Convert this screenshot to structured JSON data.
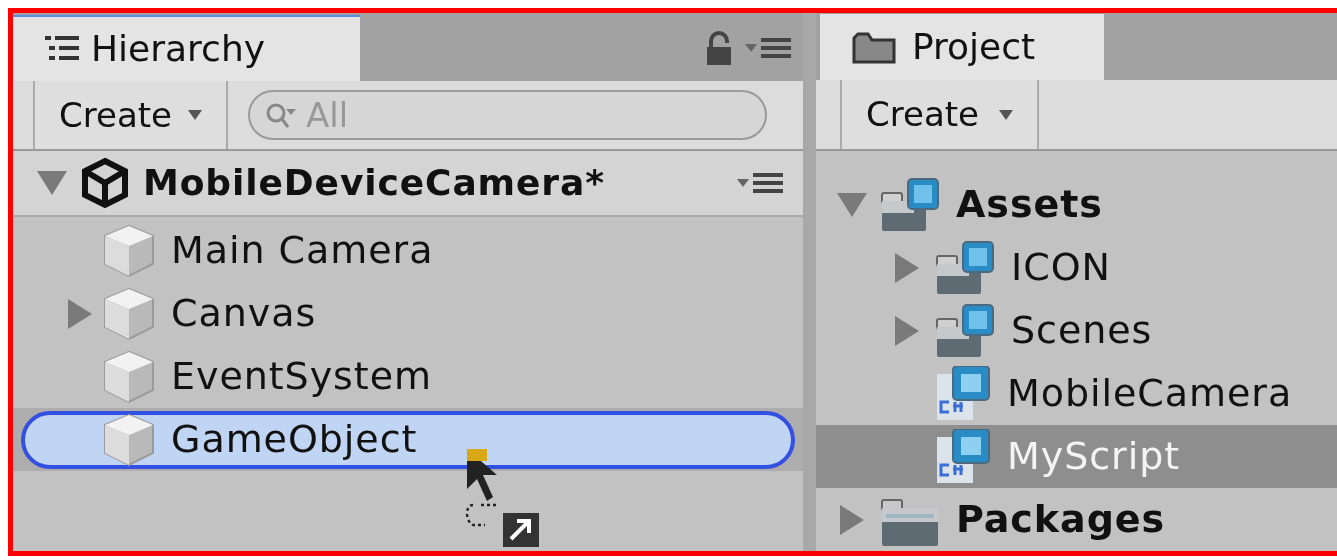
{
  "hierarchy": {
    "tab": {
      "label": "Hierarchy",
      "selected": true
    },
    "create_button": "Create",
    "search": {
      "placeholder": "All"
    },
    "scene": {
      "name": "MobileDeviceCamera*",
      "expanded": true
    },
    "items": [
      {
        "name": "Main Camera",
        "selected": false
      },
      {
        "name": "Canvas",
        "expanded": false,
        "selected": false
      },
      {
        "name": "EventSystem",
        "selected": false
      },
      {
        "name": "GameObject",
        "selected": true
      }
    ]
  },
  "project": {
    "tab": {
      "label": "Project",
      "selected": true
    },
    "create_button": "Create",
    "tree": [
      {
        "name": "Assets",
        "kind": "folder",
        "expanded": true,
        "selected": false,
        "children": [
          {
            "name": "ICON",
            "kind": "folder",
            "expanded": false,
            "selected": false
          },
          {
            "name": "Scenes",
            "kind": "folder",
            "expanded": false,
            "selected": false
          },
          {
            "name": "MobileCamera",
            "kind": "script",
            "selected": false
          },
          {
            "name": "MyScript",
            "kind": "script",
            "selected": true
          }
        ]
      },
      {
        "name": "Packages",
        "kind": "package",
        "expanded": false,
        "selected": false
      }
    ]
  }
}
